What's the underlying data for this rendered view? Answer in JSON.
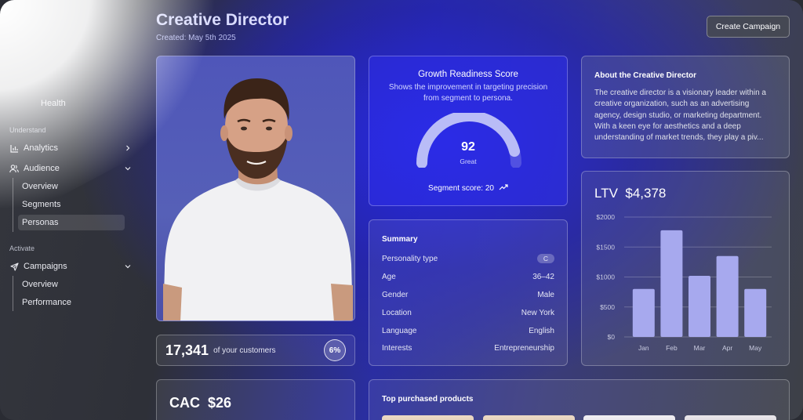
{
  "sidebar": {
    "partial_item": "Health",
    "section_understand": "Understand",
    "section_activate": "Activate",
    "items": {
      "analytics": "Analytics",
      "audience": "Audience",
      "campaigns": "Campaigns"
    },
    "audience_sub": [
      "Overview",
      "Segments",
      "Personas"
    ],
    "campaigns_sub": [
      "Overview",
      "Performance"
    ]
  },
  "header": {
    "title": "Creative Director",
    "created": "Created: May 5th 2025",
    "create_button": "Create Campaign"
  },
  "customers": {
    "count": "17,341",
    "label": "of your customers",
    "percent": "6%"
  },
  "cac": {
    "label": "CAC",
    "value": "$26"
  },
  "score": {
    "title": "Growth Readiness Score",
    "description": "Shows the improvement in targeting precision from segment to persona.",
    "value": "92",
    "value_number": 92,
    "rating": "Great",
    "segment_label": "Segment score: 20"
  },
  "summary": {
    "title": "Summary",
    "rows": [
      {
        "label": "Personality type",
        "value": "C"
      },
      {
        "label": "Age",
        "value": "36–42"
      },
      {
        "label": "Gender",
        "value": "Male"
      },
      {
        "label": "Location",
        "value": "New York"
      },
      {
        "label": "Language",
        "value": "English"
      },
      {
        "label": "Interests",
        "value": "Entrepreneurship"
      }
    ]
  },
  "about": {
    "title": "About the Creative Director",
    "text": "The creative director is a visionary leader within a creative organization, such as an advertising agency, design studio, or marketing department. With a keen eye for aesthetics and a deep understanding of market trends, they play a piv..."
  },
  "products": {
    "title": "Top purchased products"
  },
  "ltv": {
    "label": "LTV",
    "value": "$4,378"
  },
  "chart_data": {
    "type": "bar",
    "title": "LTV $4,378",
    "categories": [
      "Jan",
      "Feb",
      "Mar",
      "Apr",
      "May"
    ],
    "values": [
      800,
      1780,
      1020,
      1350,
      800
    ],
    "ylim": [
      0,
      2000
    ],
    "yticks": [
      "$0",
      "$500",
      "$1000",
      "$1500",
      "$2000"
    ],
    "ytick_values": [
      0,
      500,
      1000,
      1500,
      2000
    ],
    "grid": true,
    "bar_color": "#a7a9ee"
  },
  "colors": {
    "accent": "#2e2ee6",
    "gauge": "#b9bcf7"
  }
}
